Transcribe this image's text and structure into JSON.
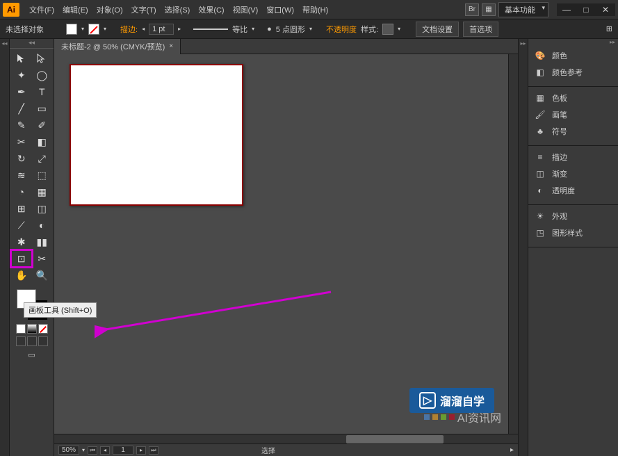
{
  "app": {
    "logo": "Ai",
    "workspace_label": "基本功能"
  },
  "menu": [
    "文件(F)",
    "编辑(E)",
    "对象(O)",
    "文字(T)",
    "选择(S)",
    "效果(C)",
    "视图(V)",
    "窗口(W)",
    "帮助(H)"
  ],
  "window_controls": {
    "min": "—",
    "max": "□",
    "close": "✕"
  },
  "control_bar": {
    "selection_label": "未选择对象",
    "stroke_label": "描边:",
    "stroke_width": "1 pt",
    "uniform_label": "等比",
    "brush_label": "5 点圆形",
    "opacity_label": "不透明度",
    "style_label": "样式:",
    "doc_setup": "文档设置",
    "preferences": "首选项"
  },
  "document": {
    "tab_title": "未标题-2 @ 50% (CMYK/预览)",
    "zoom": "50%",
    "page": "1",
    "status_text": "选择"
  },
  "tooltip": "画板工具 (Shift+O)",
  "panels": {
    "group1": [
      {
        "icon": "palette",
        "label": "颜色"
      },
      {
        "icon": "guide",
        "label": "颜色参考"
      }
    ],
    "group2": [
      {
        "icon": "swatches",
        "label": "色板"
      },
      {
        "icon": "brush",
        "label": "画笔"
      },
      {
        "icon": "symbol",
        "label": "符号"
      }
    ],
    "group3": [
      {
        "icon": "stroke",
        "label": "描边"
      },
      {
        "icon": "gradient",
        "label": "渐变"
      },
      {
        "icon": "opacity",
        "label": "透明度"
      }
    ],
    "group4": [
      {
        "icon": "appearance",
        "label": "外观"
      },
      {
        "icon": "styles",
        "label": "图形样式"
      }
    ]
  },
  "watermark": {
    "text1": "溜溜自学",
    "text2": "AI资讯网"
  }
}
